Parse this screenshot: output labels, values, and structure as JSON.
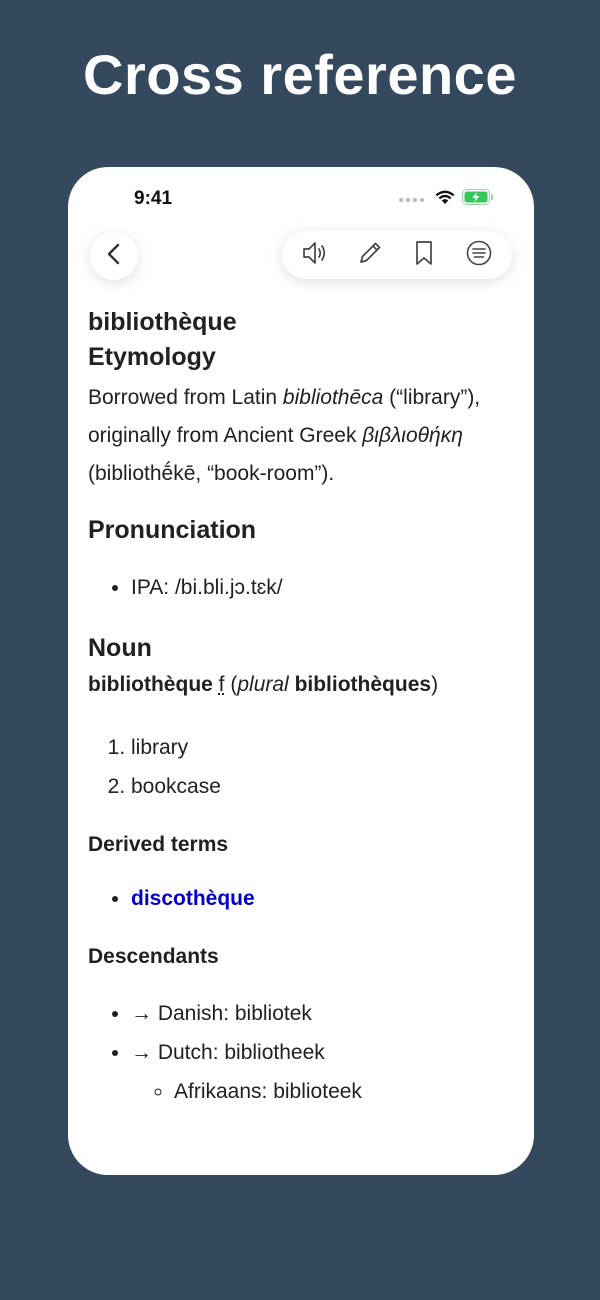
{
  "headline": "Cross reference",
  "status_bar": {
    "time": "9:41"
  },
  "entry": {
    "word": "bibliothèque",
    "etymology": {
      "heading": "Etymology",
      "text_1": "Borrowed from Latin ",
      "latin": "bibliothēca",
      "text_2": " (“library”), originally from Ancient Greek ",
      "greek": "βιβλιοθήκη",
      "text_3": " (bibliothḗkē, “book-room”)."
    },
    "pronunciation": {
      "heading": "Pronunciation",
      "ipa": "IPA: /bi.bli.jɔ.tɛk/"
    },
    "noun": {
      "heading": "Noun",
      "headword": "bibliothèque",
      "gender": "f",
      "open_paren": " (",
      "plural_label": "plural",
      "plural_form": "bibliothèques",
      "close_paren": ")",
      "senses": [
        "library",
        "bookcase"
      ]
    },
    "derived_terms": {
      "heading": "Derived terms",
      "items": [
        "discothèque"
      ]
    },
    "descendants": {
      "heading": "Descendants",
      "items": [
        {
          "label": "→ Danish: bibliotek"
        },
        {
          "label": "→ Dutch: bibliotheek",
          "children": [
            "Afrikaans: biblioteek"
          ]
        }
      ]
    }
  }
}
